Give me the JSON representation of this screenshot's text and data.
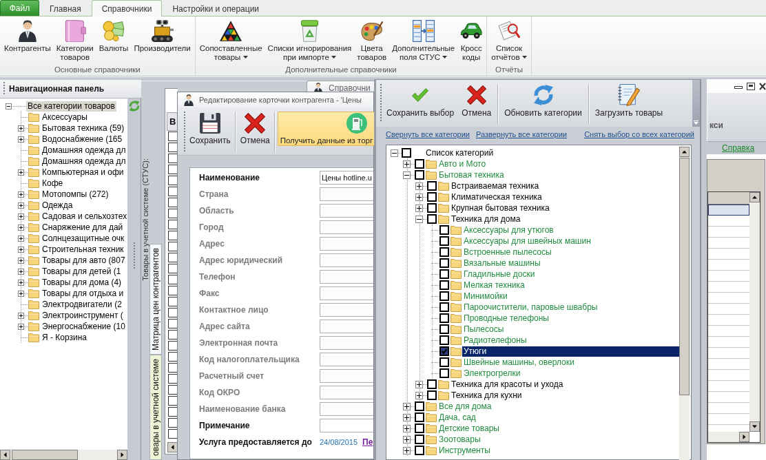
{
  "ribbon": {
    "tabs": [
      {
        "label": "Файл",
        "kind": "file",
        "selected": false
      },
      {
        "label": "Главная",
        "kind": "tab",
        "selected": false
      },
      {
        "label": "Справочники",
        "kind": "tab",
        "selected": true
      },
      {
        "label": "Настройки и операции",
        "kind": "tab",
        "selected": false
      }
    ],
    "groups": [
      {
        "label": "Основные справочники",
        "buttons": [
          {
            "label": "Контрагенты",
            "dropdown": false
          },
          {
            "label": "Категории\nтоваров",
            "dropdown": false
          },
          {
            "label": "Валюты",
            "dropdown": false
          },
          {
            "label": "Производители",
            "dropdown": false
          }
        ]
      },
      {
        "label": "Дополнительные справочники",
        "buttons": [
          {
            "label": "Сопоставленные\nтовары",
            "dropdown": true
          },
          {
            "label": "Списки игнорирования\nпри импорте",
            "dropdown": true
          },
          {
            "label": "Цвета\nтоваров",
            "dropdown": false
          },
          {
            "label": "Дополнительные\nполя СТУС",
            "dropdown": true
          },
          {
            "label": "Кросс\nкоды",
            "dropdown": false
          }
        ]
      },
      {
        "label": "Отчёты",
        "buttons": [
          {
            "label": "Список\nотчётов",
            "dropdown": true
          }
        ]
      }
    ]
  },
  "navigation_panel": {
    "title": "Навигационная панель",
    "tree": {
      "label": "Все категории товаров",
      "selected": true,
      "expandable": true,
      "expanded": true,
      "children": [
        {
          "label": "Аксессуары",
          "selected": false,
          "expandable": false
        },
        {
          "label": "Бытовая техника (59)",
          "selected": false,
          "expandable": true,
          "expanded": false
        },
        {
          "label": "Водоснабжение (165",
          "selected": false,
          "expandable": true,
          "expanded": false
        },
        {
          "label": "Домашняя одежда дл",
          "selected": false,
          "expandable": false
        },
        {
          "label": "Домашняя одежда дл",
          "selected": false,
          "expandable": false
        },
        {
          "label": "Компьютерная и офи",
          "selected": false,
          "expandable": true,
          "expanded": false
        },
        {
          "label": "Кофе",
          "selected": false,
          "expandable": false
        },
        {
          "label": "Мотопомпы (272)",
          "selected": false,
          "expandable": true,
          "expanded": false
        },
        {
          "label": "Одежда",
          "selected": false,
          "expandable": true,
          "expanded": false
        },
        {
          "label": "Садовая и сельхозтех",
          "selected": false,
          "expandable": true,
          "expanded": false
        },
        {
          "label": "Снаряжение для дай",
          "selected": false,
          "expandable": true,
          "expanded": false
        },
        {
          "label": "Солнцезащитные очк",
          "selected": false,
          "expandable": true,
          "expanded": false
        },
        {
          "label": "Строительная техник",
          "selected": false,
          "expandable": true,
          "expanded": false
        },
        {
          "label": "Товары для авто (807",
          "selected": false,
          "expandable": true,
          "expanded": false
        },
        {
          "label": "Товары для детей (1",
          "selected": false,
          "expandable": true,
          "expanded": false
        },
        {
          "label": "Товары для дома (4)",
          "selected": false,
          "expandable": true,
          "expanded": false
        },
        {
          "label": "Товары для отдыха и",
          "selected": false,
          "expandable": true,
          "expanded": false
        },
        {
          "label": "Электродвигатели (2",
          "selected": false,
          "expandable": false
        },
        {
          "label": "Электроинструмент (",
          "selected": false,
          "expandable": true,
          "expanded": false
        },
        {
          "label": "Энергоснабжение (10",
          "selected": false,
          "expandable": true,
          "expanded": false
        },
        {
          "label": "Я - Корзина",
          "selected": false,
          "expandable": false
        }
      ]
    }
  },
  "background_window": {
    "caption": "Товары в учетной системе (СТУС):",
    "tabs": [
      {
        "label": "Матрица цен контрагентов",
        "selected": false
      },
      {
        "label": "овары в учетной системе",
        "selected": true
      }
    ],
    "grid": {
      "columns": [
        "В"
      ],
      "rows": [
        {
          "checked": false
        },
        {
          "checked": false
        },
        {
          "checked": false
        },
        {
          "checked": false
        },
        {
          "checked": false
        },
        {
          "checked": false
        },
        {
          "checked": false
        },
        {
          "checked": false
        },
        {
          "checked": false
        },
        {
          "checked": false
        },
        {
          "checked": false
        },
        {
          "checked": false
        },
        {
          "checked": false
        },
        {
          "checked": false
        },
        {
          "checked": false
        },
        {
          "checked": false
        },
        {
          "checked": false
        },
        {
          "checked": false
        },
        {
          "checked": false
        },
        {
          "checked": false
        },
        {
          "checked": false
        },
        {
          "checked": false
        },
        {
          "checked": false
        },
        {
          "checked": false
        },
        {
          "checked": false
        },
        {
          "checked": false
        },
        {
          "checked": false
        },
        {
          "checked": false
        }
      ]
    }
  },
  "reference_window_tab": {
    "title": "Справочни"
  },
  "counterparty_dialog": {
    "title": "Редактирование карточки контрагента - 'Цены",
    "toolbar": [
      {
        "label": "Сохранить",
        "highlighted": false
      },
      {
        "label": "Отмена",
        "highlighted": false
      },
      {
        "label": "Получить данные из торг",
        "highlighted": true
      }
    ],
    "fields": [
      {
        "label": "Наименование",
        "disabled": false,
        "value": "Цены hotline.u"
      },
      {
        "label": "Страна",
        "disabled": true
      },
      {
        "label": "Область",
        "disabled": true
      },
      {
        "label": "Город",
        "disabled": true
      },
      {
        "label": "Адрес",
        "disabled": true
      },
      {
        "label": "Адрес юридический",
        "disabled": true
      },
      {
        "label": "Телефон",
        "disabled": true
      },
      {
        "label": "Факс",
        "disabled": true
      },
      {
        "label": "Контактное лицо",
        "disabled": true
      },
      {
        "label": "Адрес сайта",
        "disabled": true
      },
      {
        "label": "Электронная почта",
        "disabled": true
      },
      {
        "label": "Код налогоплательщика",
        "disabled": true
      },
      {
        "label": "Расчетный счет",
        "disabled": true
      },
      {
        "label": "Код ОКРО",
        "disabled": true
      },
      {
        "label": "Наименование банка",
        "disabled": true
      },
      {
        "label": "Примечание",
        "disabled": false
      }
    ],
    "service": {
      "label": "Услуга предоставляется до",
      "date": "24/08/2015",
      "link": "Пе"
    }
  },
  "categories_dialog": {
    "toolbar": [
      {
        "label": "Сохранить выбор"
      },
      {
        "label": "Отмена"
      },
      {
        "label": "Обновить категории"
      },
      {
        "label": "Загрузить товары"
      }
    ],
    "links": [
      "Свернуть все категории",
      "Развернуть все категории",
      "Снять выбор со всех категорий"
    ],
    "tree": {
      "label": "Список категорий",
      "color": "#000000",
      "checked": false,
      "selected": false,
      "expandable": true,
      "expanded": true,
      "children": [
        {
          "label": "Авто и Мото",
          "color": "#1e8a3c",
          "checked": false,
          "selected": false,
          "expandable": true,
          "expanded": false
        },
        {
          "label": "Бытовая техника",
          "color": "#1e8a3c",
          "checked": false,
          "selected": false,
          "expandable": true,
          "expanded": true,
          "children": [
            {
              "label": "Встраиваемая техника",
              "color": "#000000",
              "checked": false,
              "selected": false,
              "expandable": true,
              "expanded": false
            },
            {
              "label": "Климатическая техника",
              "color": "#000000",
              "checked": false,
              "selected": false,
              "expandable": true,
              "expanded": false
            },
            {
              "label": "Крупная бытовая техника",
              "color": "#000000",
              "checked": false,
              "selected": false,
              "expandable": true,
              "expanded": false
            },
            {
              "label": "Техника для дома",
              "color": "#000000",
              "checked": false,
              "selected": false,
              "expandable": true,
              "expanded": true,
              "children": [
                {
                  "label": "Аксессуары для утюгов",
                  "color": "#1e8a3c",
                  "checked": false,
                  "selected": false,
                  "expandable": false
                },
                {
                  "label": "Аксессуары для швейных машин",
                  "color": "#1e8a3c",
                  "checked": false,
                  "selected": false,
                  "expandable": false
                },
                {
                  "label": "Встроенные пылесосы",
                  "color": "#1e8a3c",
                  "checked": false,
                  "selected": false,
                  "expandable": false
                },
                {
                  "label": "Вязальные машины",
                  "color": "#1e8a3c",
                  "checked": false,
                  "selected": false,
                  "expandable": false
                },
                {
                  "label": "Гладильные доски",
                  "color": "#1e8a3c",
                  "checked": false,
                  "selected": false,
                  "expandable": false
                },
                {
                  "label": "Мелкая техника",
                  "color": "#1e8a3c",
                  "checked": false,
                  "selected": false,
                  "expandable": false
                },
                {
                  "label": "Минимойки",
                  "color": "#1e8a3c",
                  "checked": false,
                  "selected": false,
                  "expandable": false
                },
                {
                  "label": "Пароочистители, паровые швабры",
                  "color": "#1e8a3c",
                  "checked": false,
                  "selected": false,
                  "expandable": false
                },
                {
                  "label": "Проводные телефоны",
                  "color": "#1e8a3c",
                  "checked": false,
                  "selected": false,
                  "expandable": false
                },
                {
                  "label": "Пылесосы",
                  "color": "#1e8a3c",
                  "checked": false,
                  "selected": false,
                  "expandable": false
                },
                {
                  "label": "Радиотелефоны",
                  "color": "#1e8a3c",
                  "checked": false,
                  "selected": false,
                  "expandable": false
                },
                {
                  "label": "Утюги",
                  "checked": true,
                  "selected": true,
                  "expandable": false
                },
                {
                  "label": "Швейные машины, оверлоки",
                  "color": "#1e8a3c",
                  "checked": false,
                  "selected": false,
                  "expandable": false
                },
                {
                  "label": "Электрогрелки",
                  "color": "#1e8a3c",
                  "checked": false,
                  "selected": false,
                  "expandable": false
                }
              ]
            },
            {
              "label": "Техника для красоты и ухода",
              "color": "#000000",
              "checked": false,
              "selected": false,
              "expandable": true,
              "expanded": false
            },
            {
              "label": "Техника для кухни",
              "color": "#000000",
              "checked": false,
              "selected": false,
              "expandable": true,
              "expanded": false
            }
          ]
        },
        {
          "label": "Все для дома",
          "color": "#1e8a3c",
          "checked": false,
          "selected": false,
          "expandable": true,
          "expanded": false
        },
        {
          "label": "Дача, сад",
          "color": "#1e8a3c",
          "checked": false,
          "selected": false,
          "expandable": true,
          "expanded": false
        },
        {
          "label": "Детские товары",
          "color": "#1e8a3c",
          "checked": false,
          "selected": false,
          "expandable": true,
          "expanded": false
        },
        {
          "label": "Зоотовары",
          "color": "#1e8a3c",
          "checked": false,
          "selected": false,
          "expandable": true,
          "expanded": false
        },
        {
          "label": "Инструменты",
          "color": "#1e8a3c",
          "checked": false,
          "selected": false,
          "expandable": true,
          "expanded": false
        }
      ]
    }
  },
  "right_window": {
    "ribbon_text": "кси",
    "help_link": "Справка",
    "grid": {
      "rows": [
        {
          "selected": true
        },
        {
          "selected": false
        },
        {
          "selected": false
        },
        {
          "selected": false
        },
        {
          "selected": false
        },
        {
          "selected": false
        },
        {
          "selected": false
        },
        {
          "selected": false
        },
        {
          "selected": false
        },
        {
          "selected": false
        },
        {
          "selected": false
        },
        {
          "selected": false
        },
        {
          "selected": false
        },
        {
          "selected": false
        },
        {
          "selected": false
        },
        {
          "selected": false
        },
        {
          "selected": false
        },
        {
          "selected": false
        },
        {
          "selected": false
        },
        {
          "selected": false
        }
      ]
    }
  }
}
